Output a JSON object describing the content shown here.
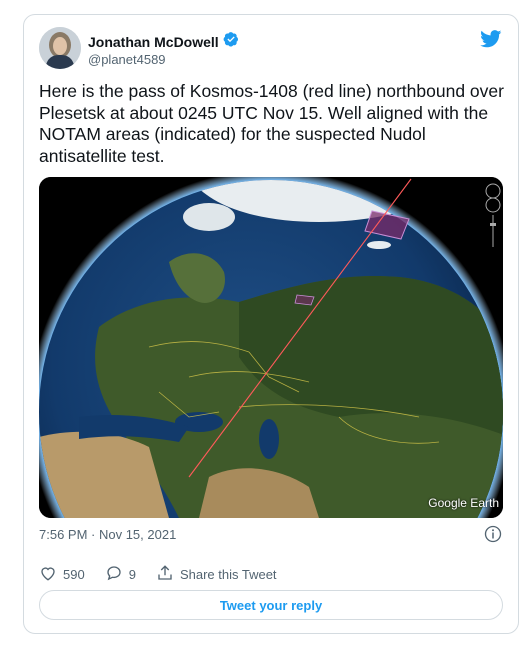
{
  "author": {
    "name": "Jonathan McDowell",
    "handle": "@planet4589",
    "verified": true
  },
  "tweet": {
    "text": "Here is the pass of Kosmos-1408 (red line) northbound over Plesetsk at about 0245 UTC Nov 15. Well aligned with the NOTAM areas (indicated) for the suspected Nudol antisatellite test.",
    "timestamp": "7:56 PM · Nov 15, 2021"
  },
  "media": {
    "watermark": "Google Earth"
  },
  "actions": {
    "likes": "590",
    "replies": "9",
    "share_label": "Share this Tweet"
  },
  "reply": {
    "button_label": "Tweet your reply"
  },
  "colors": {
    "twitter_blue": "#1d9bf0",
    "text_primary": "#0f1419",
    "text_secondary": "#536471",
    "border": "#d4dbe0",
    "orbit_line": "#ff5a5a"
  },
  "icons": [
    "verified-badge-icon",
    "twitter-bird-icon",
    "info-icon",
    "heart-icon",
    "reply-icon",
    "share-icon"
  ]
}
